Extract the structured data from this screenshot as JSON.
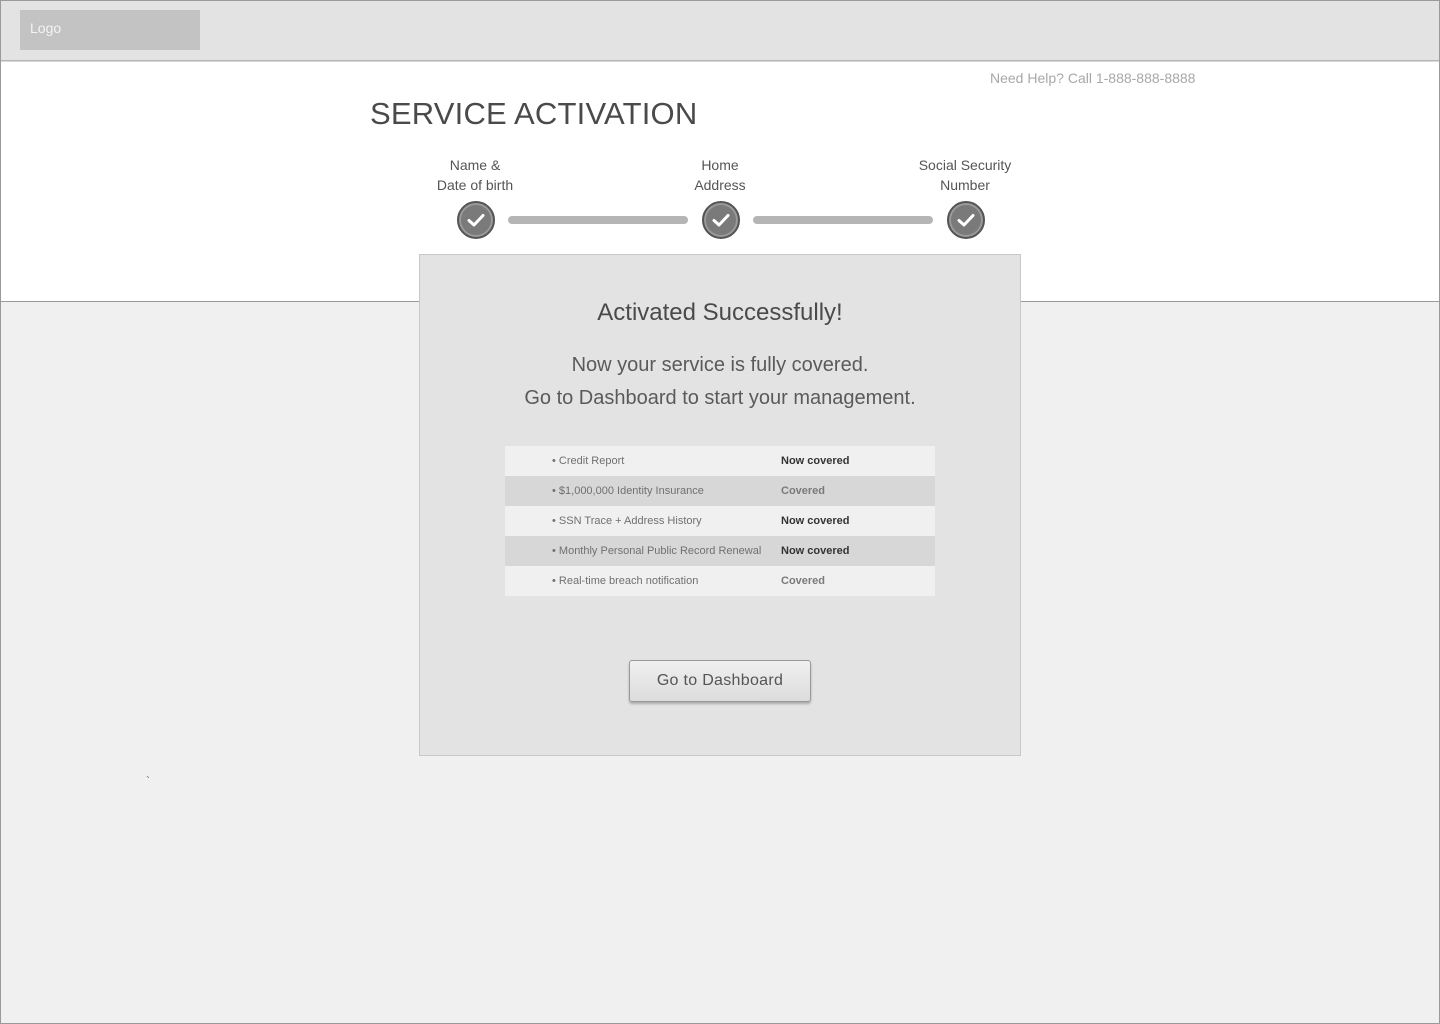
{
  "header": {
    "logo_text": "Logo"
  },
  "help": {
    "text": "Need Help? Call 1-888-888-8888"
  },
  "page": {
    "title": "SERVICE ACTIVATION"
  },
  "steps": [
    {
      "line1": "Name &",
      "line2": "Date of birth",
      "status": "complete",
      "icon": "checkmark-icon"
    },
    {
      "line1": "Home",
      "line2": "Address",
      "status": "complete",
      "icon": "checkmark-icon"
    },
    {
      "line1": "Social Security",
      "line2": "Number",
      "status": "complete",
      "icon": "checkmark-icon"
    }
  ],
  "panel": {
    "title": "Activated Successfully!",
    "message_line1": "Now your service is fully covered.",
    "message_line2": "Go to Dashboard to start your management.",
    "coverage": [
      {
        "item": "• Credit Report",
        "status": "Now covered"
      },
      {
        "item": "• $1,000,000 Identity Insurance",
        "status": "Covered"
      },
      {
        "item": "• SSN Trace + Address History",
        "status": "Now covered"
      },
      {
        "item": "• Monthly Personal Public Record Renewal",
        "status": "Now covered"
      },
      {
        "item": "• Real-time breach notification",
        "status": "Covered"
      }
    ],
    "button_label": "Go to Dashboard"
  },
  "stray_mark": "`",
  "colors": {
    "header_bg": "#e3e3e3",
    "panel_bg": "#e3e3e3",
    "page_bg": "#f0f0f0",
    "step_circle": "#7a7a7a"
  }
}
